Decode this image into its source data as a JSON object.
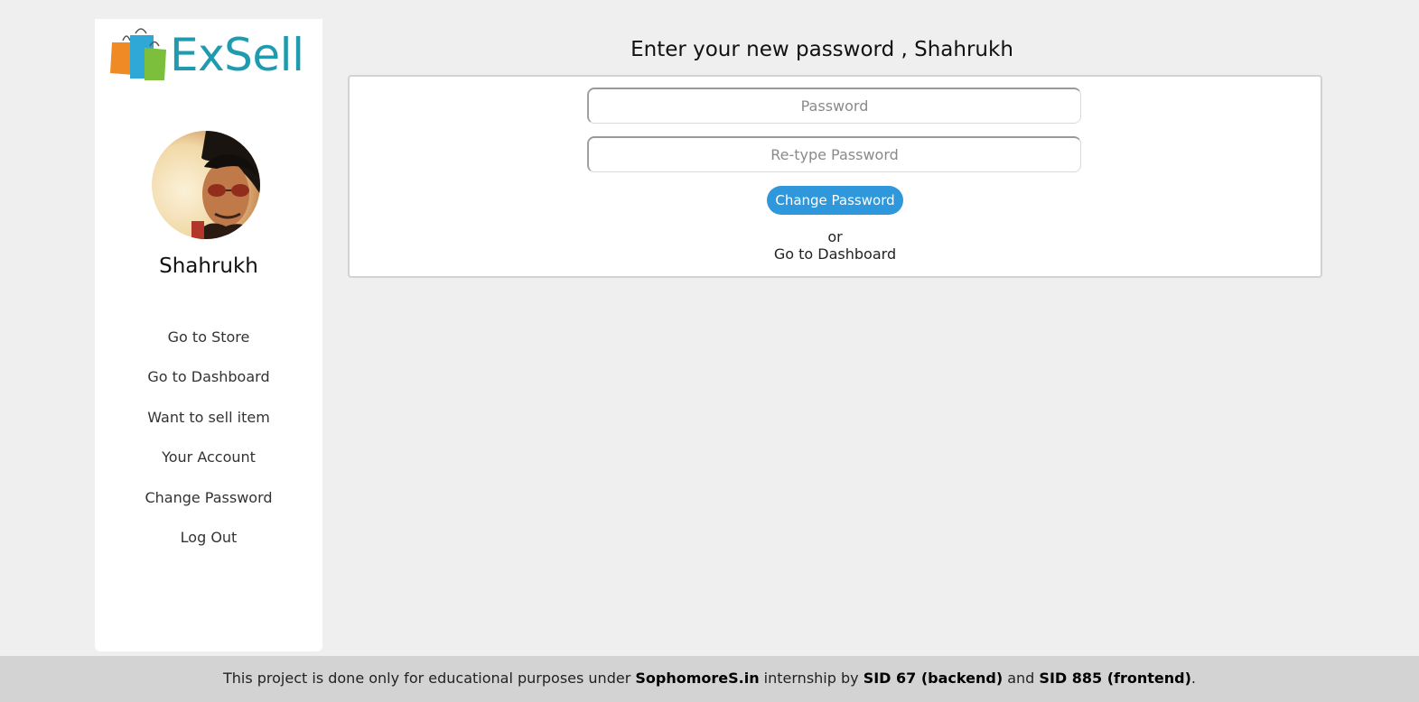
{
  "brand": {
    "name": "ExSell",
    "color": "#1f9bb0",
    "bag_colors": [
      "#f08a24",
      "#2fa8d8",
      "#7bbf3c"
    ]
  },
  "user": {
    "name": "Shahrukh"
  },
  "sidebar": {
    "items": [
      {
        "label": "Go to Store"
      },
      {
        "label": "Go to Dashboard"
      },
      {
        "label": "Want to sell item"
      },
      {
        "label": "Your Account"
      },
      {
        "label": "Change Password"
      },
      {
        "label": "Log Out"
      }
    ]
  },
  "main": {
    "title": "Enter your new password , Shahrukh",
    "password_placeholder": "Password",
    "retype_placeholder": "Re-type Password",
    "submit_label": "Change Password",
    "or_text": "or",
    "dashboard_link": "Go to Dashboard",
    "accent_color": "#2f97db"
  },
  "footer": {
    "text1": "This project is done only for educational purposes under ",
    "site": "SophomoreS.in",
    "text2": " internship by ",
    "sid1": "SID 67 (backend)",
    "text3": " and ",
    "sid2": "SID 885 (frontend)",
    "text4": "."
  }
}
